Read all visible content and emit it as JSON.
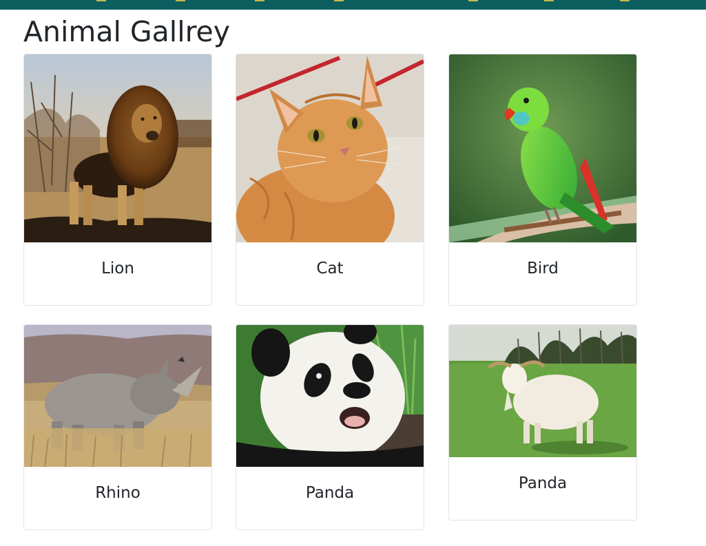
{
  "page": {
    "title": "Animal Gallrey"
  },
  "gallery": {
    "cards": [
      {
        "name": "Lion",
        "image": "lion-photo"
      },
      {
        "name": "Cat",
        "image": "cat-photo"
      },
      {
        "name": "Bird",
        "image": "parrot-photo"
      },
      {
        "name": "Rhino",
        "image": "rhino-photo"
      },
      {
        "name": "Panda",
        "image": "panda-photo"
      },
      {
        "name": "Panda",
        "image": "goat-photo"
      }
    ]
  }
}
